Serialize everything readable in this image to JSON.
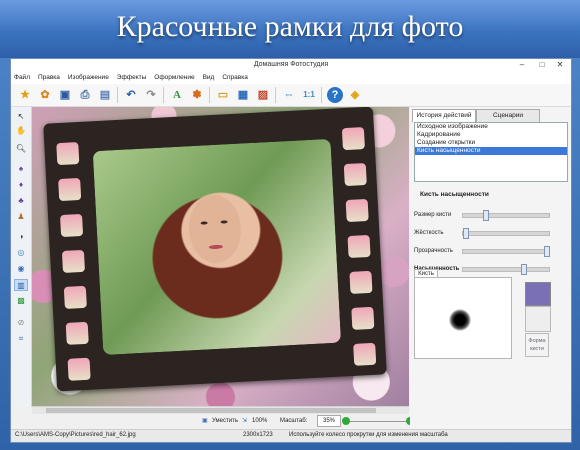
{
  "banner": {
    "title": "Красочные рамки для фото"
  },
  "window": {
    "title": "Домашняя Фотостудия",
    "controls": {
      "minimize": "–",
      "maximize": "□",
      "close": "✕"
    }
  },
  "menu": [
    "Файл",
    "Правка",
    "Изображение",
    "Эффекты",
    "Оформление",
    "Вид",
    "Справка"
  ],
  "toolbar_icons": [
    "open-icon",
    "palette-icon",
    "save-icon",
    "print-icon",
    "export-icon",
    "undo-icon",
    "redo-icon",
    "text-icon",
    "effects-icon",
    "frame-icon",
    "calendar-icon",
    "image-icon",
    "fit-icon",
    "zoom-100-icon",
    "help-icon",
    "share-icon"
  ],
  "right_panel": {
    "tabs": [
      "История действий",
      "Сценарии"
    ],
    "history": [
      "Исходное изображение",
      "Кадрирование",
      "Создание открытки",
      "Кисть насыщенности"
    ],
    "selected_history": 3,
    "section_title": "Кисть насыщенности",
    "params": [
      {
        "label": "Размер кисти",
        "value": 0.25
      },
      {
        "label": "Жёсткость",
        "value": 0.0
      },
      {
        "label": "Прозрачность",
        "value": 1.0
      },
      {
        "label": "Насыщенность",
        "value": 0.72
      }
    ],
    "brush_tab": "Кисть",
    "form_label": "Форма кисти",
    "color": "#7a70b5"
  },
  "zoom": {
    "fit_label": "Уместить",
    "zoom100_label": "100%",
    "scale_label": "Масштаб:",
    "scale_value": "35%"
  },
  "status": {
    "path": "C:\\Users\\AMS-Copy\\Pictures\\red_hair_62.jpg",
    "size": "2300x1723",
    "hint": "Используйте колесо прокрутки для изменения масштаба"
  }
}
